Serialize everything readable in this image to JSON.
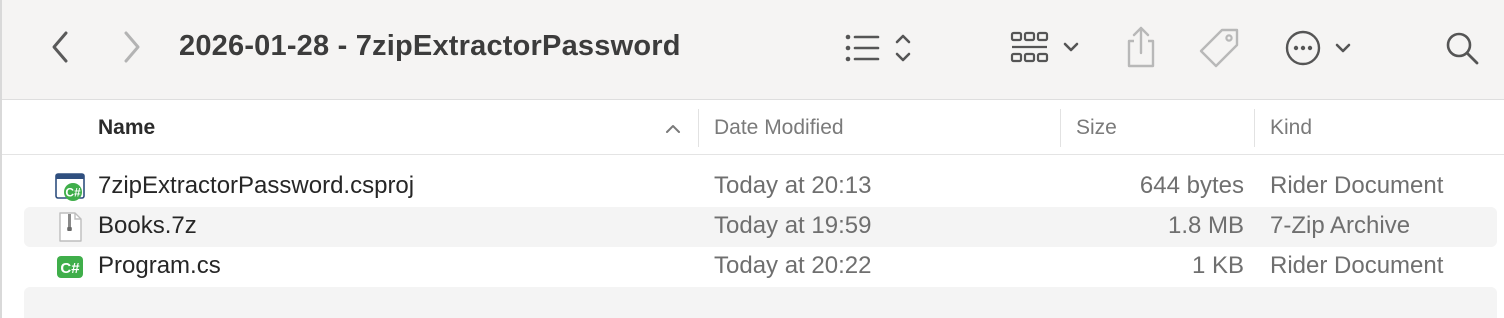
{
  "window": {
    "title": "2026-01-28 - 7zipExtractorPassword"
  },
  "toolbar": {
    "icons": [
      "chevron-left-icon",
      "chevron-right-icon",
      "list-view-icon",
      "group-by-icon",
      "share-icon",
      "tag-icon",
      "more-icon",
      "search-icon"
    ]
  },
  "columns": {
    "name": "Name",
    "date": "Date Modified",
    "size": "Size",
    "kind": "Kind",
    "sort_column": "Name",
    "sort_direction": "ascending"
  },
  "files": [
    {
      "name": "7zipExtractorPassword.csproj",
      "date": "Today at 20:13",
      "size": "644 bytes",
      "kind": "Rider Document",
      "icon": "csproj-file-icon"
    },
    {
      "name": "Books.7z",
      "date": "Today at 19:59",
      "size": "1.8 MB",
      "kind": "7-Zip Archive",
      "icon": "archive-file-icon"
    },
    {
      "name": "Program.cs",
      "date": "Today at 20:22",
      "size": "1 KB",
      "kind": "Rider Document",
      "icon": "csharp-file-icon"
    }
  ],
  "colors": {
    "toolbar_bg": "#f5f4f3",
    "alt_row": "#f4f4f4",
    "csharp_green": "#3fae4a"
  }
}
